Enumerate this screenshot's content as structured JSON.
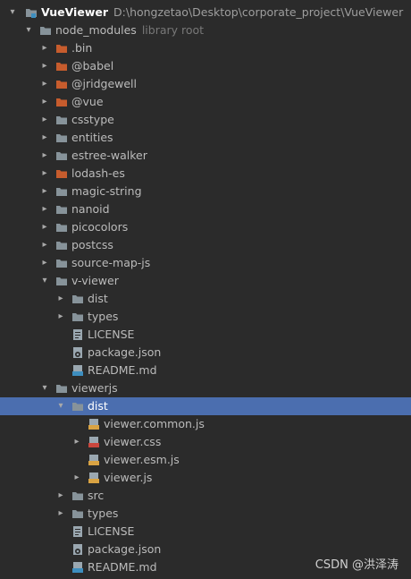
{
  "project": {
    "name": "VueViewer",
    "path": "D:\\hongzetao\\Desktop\\corporate_project\\VueViewer"
  },
  "colors": {
    "background": "#2b2b2b",
    "selection": "#4b6eaf",
    "folder": "#87939a",
    "folder_excluded": "#c75c2d",
    "text": "#bbbbbb"
  },
  "tree": [
    {
      "depth": 1,
      "type": "folder",
      "arrow": "open",
      "label": "node_modules",
      "hint": "library root"
    },
    {
      "depth": 2,
      "type": "folder-orange",
      "arrow": "closed",
      "label": ".bin"
    },
    {
      "depth": 2,
      "type": "folder-orange",
      "arrow": "closed",
      "label": "@babel"
    },
    {
      "depth": 2,
      "type": "folder-orange",
      "arrow": "closed",
      "label": "@jridgewell"
    },
    {
      "depth": 2,
      "type": "folder-orange",
      "arrow": "closed",
      "label": "@vue"
    },
    {
      "depth": 2,
      "type": "folder",
      "arrow": "closed",
      "label": "csstype"
    },
    {
      "depth": 2,
      "type": "folder",
      "arrow": "closed",
      "label": "entities"
    },
    {
      "depth": 2,
      "type": "folder",
      "arrow": "closed",
      "label": "estree-walker"
    },
    {
      "depth": 2,
      "type": "folder-orange",
      "arrow": "closed",
      "label": "lodash-es"
    },
    {
      "depth": 2,
      "type": "folder",
      "arrow": "closed",
      "label": "magic-string"
    },
    {
      "depth": 2,
      "type": "folder",
      "arrow": "closed",
      "label": "nanoid"
    },
    {
      "depth": 2,
      "type": "folder",
      "arrow": "closed",
      "label": "picocolors"
    },
    {
      "depth": 2,
      "type": "folder",
      "arrow": "closed",
      "label": "postcss"
    },
    {
      "depth": 2,
      "type": "folder",
      "arrow": "closed",
      "label": "source-map-js"
    },
    {
      "depth": 2,
      "type": "folder",
      "arrow": "open",
      "label": "v-viewer"
    },
    {
      "depth": 3,
      "type": "folder",
      "arrow": "closed",
      "label": "dist"
    },
    {
      "depth": 3,
      "type": "folder",
      "arrow": "closed",
      "label": "types"
    },
    {
      "depth": 3,
      "type": "file-text",
      "arrow": "none",
      "label": "LICENSE"
    },
    {
      "depth": 3,
      "type": "file-json",
      "arrow": "none",
      "label": "package.json"
    },
    {
      "depth": 3,
      "type": "file-md",
      "arrow": "none",
      "label": "README.md"
    },
    {
      "depth": 2,
      "type": "folder",
      "arrow": "open",
      "label": "viewerjs"
    },
    {
      "depth": 3,
      "type": "folder",
      "arrow": "open",
      "label": "dist",
      "selected": true
    },
    {
      "depth": 4,
      "type": "file-js",
      "arrow": "none",
      "label": "viewer.common.js"
    },
    {
      "depth": 4,
      "type": "file-css",
      "arrow": "closed",
      "label": "viewer.css"
    },
    {
      "depth": 4,
      "type": "file-js",
      "arrow": "none",
      "label": "viewer.esm.js"
    },
    {
      "depth": 4,
      "type": "file-js",
      "arrow": "closed",
      "label": "viewer.js"
    },
    {
      "depth": 3,
      "type": "folder",
      "arrow": "closed",
      "label": "src"
    },
    {
      "depth": 3,
      "type": "folder",
      "arrow": "closed",
      "label": "types"
    },
    {
      "depth": 3,
      "type": "file-text",
      "arrow": "none",
      "label": "LICENSE"
    },
    {
      "depth": 3,
      "type": "file-json",
      "arrow": "none",
      "label": "package.json"
    },
    {
      "depth": 3,
      "type": "file-md",
      "arrow": "none",
      "label": "README.md"
    }
  ],
  "watermark": "CSDN @洪泽涛"
}
